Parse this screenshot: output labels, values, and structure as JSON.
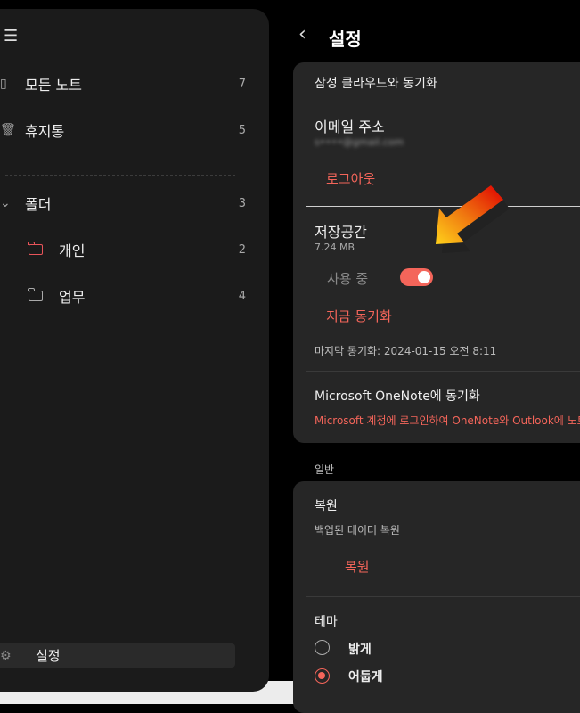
{
  "sidebar": {
    "items": [
      {
        "label": "모든 노트",
        "count": "7"
      },
      {
        "label": "휴지통",
        "count": "5"
      }
    ],
    "folders_label": "폴더",
    "folders_count": "3",
    "folders": [
      {
        "label": "개인",
        "count": "2"
      },
      {
        "label": "업무",
        "count": "4"
      }
    ],
    "settings_label": "설정"
  },
  "header": {
    "title": "설정"
  },
  "sync": {
    "section_title": "삼성 클라우드와 동기화",
    "email_label": "이메일 주소",
    "email_value": "s••••@gmail.com",
    "logout": "로그아웃",
    "storage_label": "저장공간",
    "storage_value": "7.24 MB",
    "in_use_label": "사용 중",
    "in_use_on": true,
    "sync_now": "지금 동기화",
    "last_sync": "마지막 동기화: 2024-01-15 오전 8:11",
    "onenote_title": "Microsoft OneNote에 동기화",
    "onenote_desc": "Microsoft 계정에 로그인하여 OneNote와 Outlook에 노트"
  },
  "general": {
    "section_label": "일반",
    "restore_title": "복원",
    "restore_desc": "백업된 데이터 복원",
    "restore_button": "복원",
    "theme_label": "테마",
    "theme_options": [
      {
        "label": "밝게",
        "selected": false
      },
      {
        "label": "어둡게",
        "selected": true
      }
    ]
  },
  "colors": {
    "accent": "#f4655a",
    "card": "#262626",
    "sidebar": "#1b1b1b"
  }
}
